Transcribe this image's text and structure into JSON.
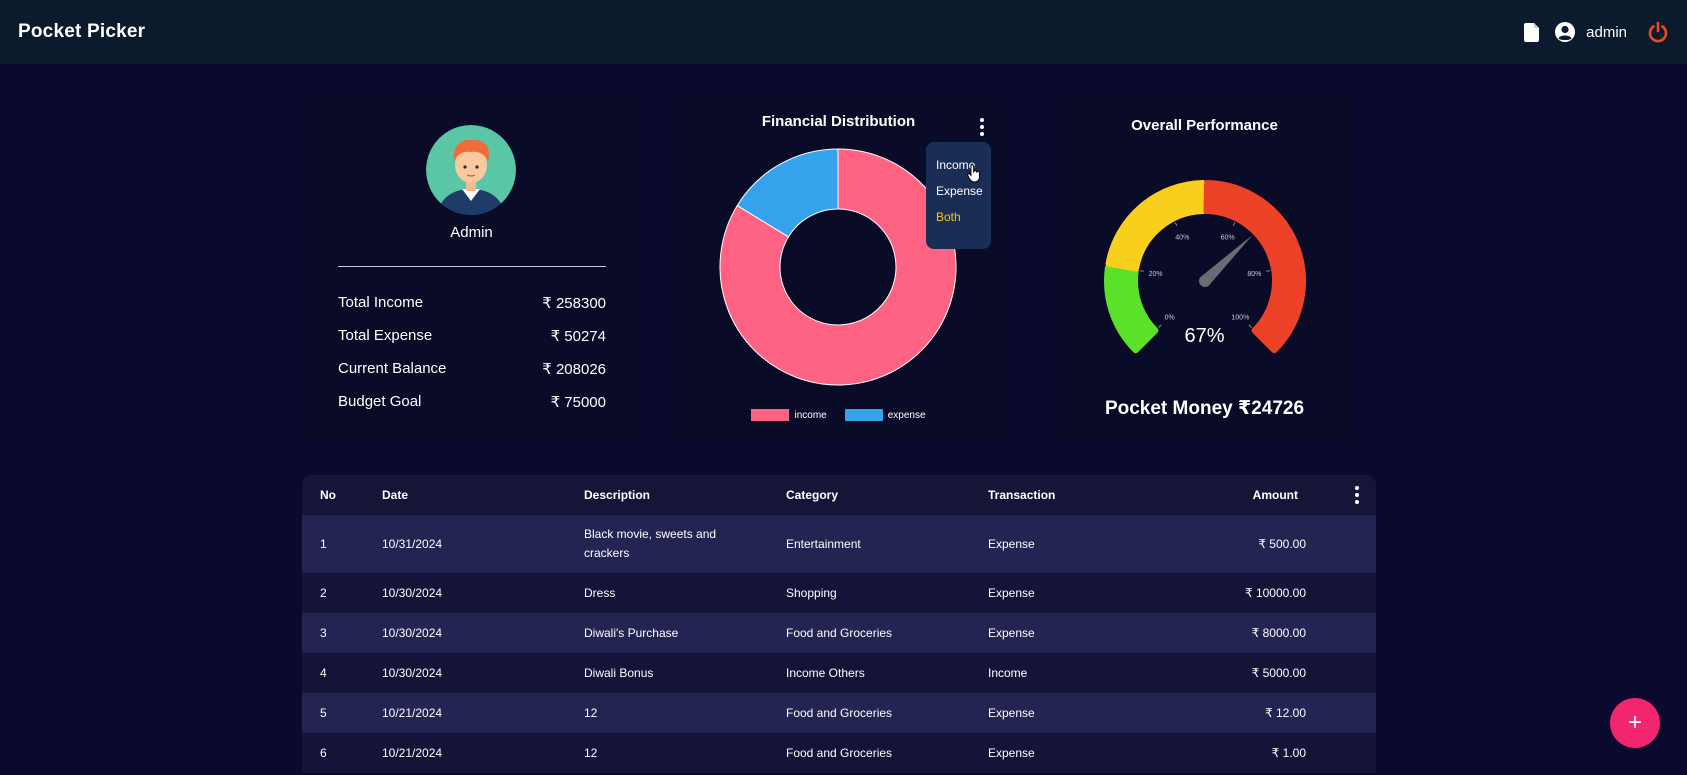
{
  "app": {
    "title": "Pocket Picker"
  },
  "header": {
    "user_name": "admin"
  },
  "profile": {
    "name": "Admin",
    "stats": [
      {
        "label": "Total Income",
        "value": "₹ 258300"
      },
      {
        "label": "Total Expense",
        "value": "₹ 50274"
      },
      {
        "label": "Current Balance",
        "value": "₹ 208026"
      },
      {
        "label": "Budget Goal",
        "value": "₹ 75000"
      }
    ]
  },
  "distribution": {
    "title": "Financial Distribution",
    "dropdown": [
      "Income",
      "Expense",
      "Both"
    ],
    "dropdown_selected": "Both",
    "legend": [
      "income",
      "expense"
    ],
    "colors": {
      "income": "#ff6384",
      "expense": "#36a2eb"
    }
  },
  "chart_data": {
    "type": "pie",
    "categories": [
      "income",
      "expense"
    ],
    "values": [
      258300,
      50274
    ]
  },
  "performance": {
    "title": "Overall Performance",
    "value_text": "67%",
    "value": 0.67,
    "tick_labels": [
      "0%",
      "20%",
      "40%",
      "60%",
      "80%",
      "100%"
    ],
    "pocket_money": "Pocket Money ₹24726",
    "zone_colors": [
      "#5ce12b",
      "#f7cf1c",
      "#ed4128"
    ]
  },
  "table": {
    "headers": {
      "no": "No",
      "date": "Date",
      "description": "Description",
      "category": "Category",
      "transaction": "Transaction",
      "amount": "Amount"
    },
    "rows": [
      {
        "no": "1",
        "date": "10/31/2024",
        "description": "Black movie, sweets and crackers",
        "category": "Entertainment",
        "transaction": "Expense",
        "amount": "₹ 500.00"
      },
      {
        "no": "2",
        "date": "10/30/2024",
        "description": "Dress",
        "category": "Shopping",
        "transaction": "Expense",
        "amount": "₹ 10000.00"
      },
      {
        "no": "3",
        "date": "10/30/2024",
        "description": "Diwali's Purchase",
        "category": "Food and Groceries",
        "transaction": "Expense",
        "amount": "₹ 8000.00"
      },
      {
        "no": "4",
        "date": "10/30/2024",
        "description": "Diwali Bonus",
        "category": "Income Others",
        "transaction": "Income",
        "amount": "₹ 5000.00"
      },
      {
        "no": "5",
        "date": "10/21/2024",
        "description": "12",
        "category": "Food and Groceries",
        "transaction": "Expense",
        "amount": "₹ 12.00"
      },
      {
        "no": "6",
        "date": "10/21/2024",
        "description": "12",
        "category": "Food and Groceries",
        "transaction": "Expense",
        "amount": "₹ 1.00"
      }
    ]
  },
  "fab": {
    "label": "+"
  }
}
